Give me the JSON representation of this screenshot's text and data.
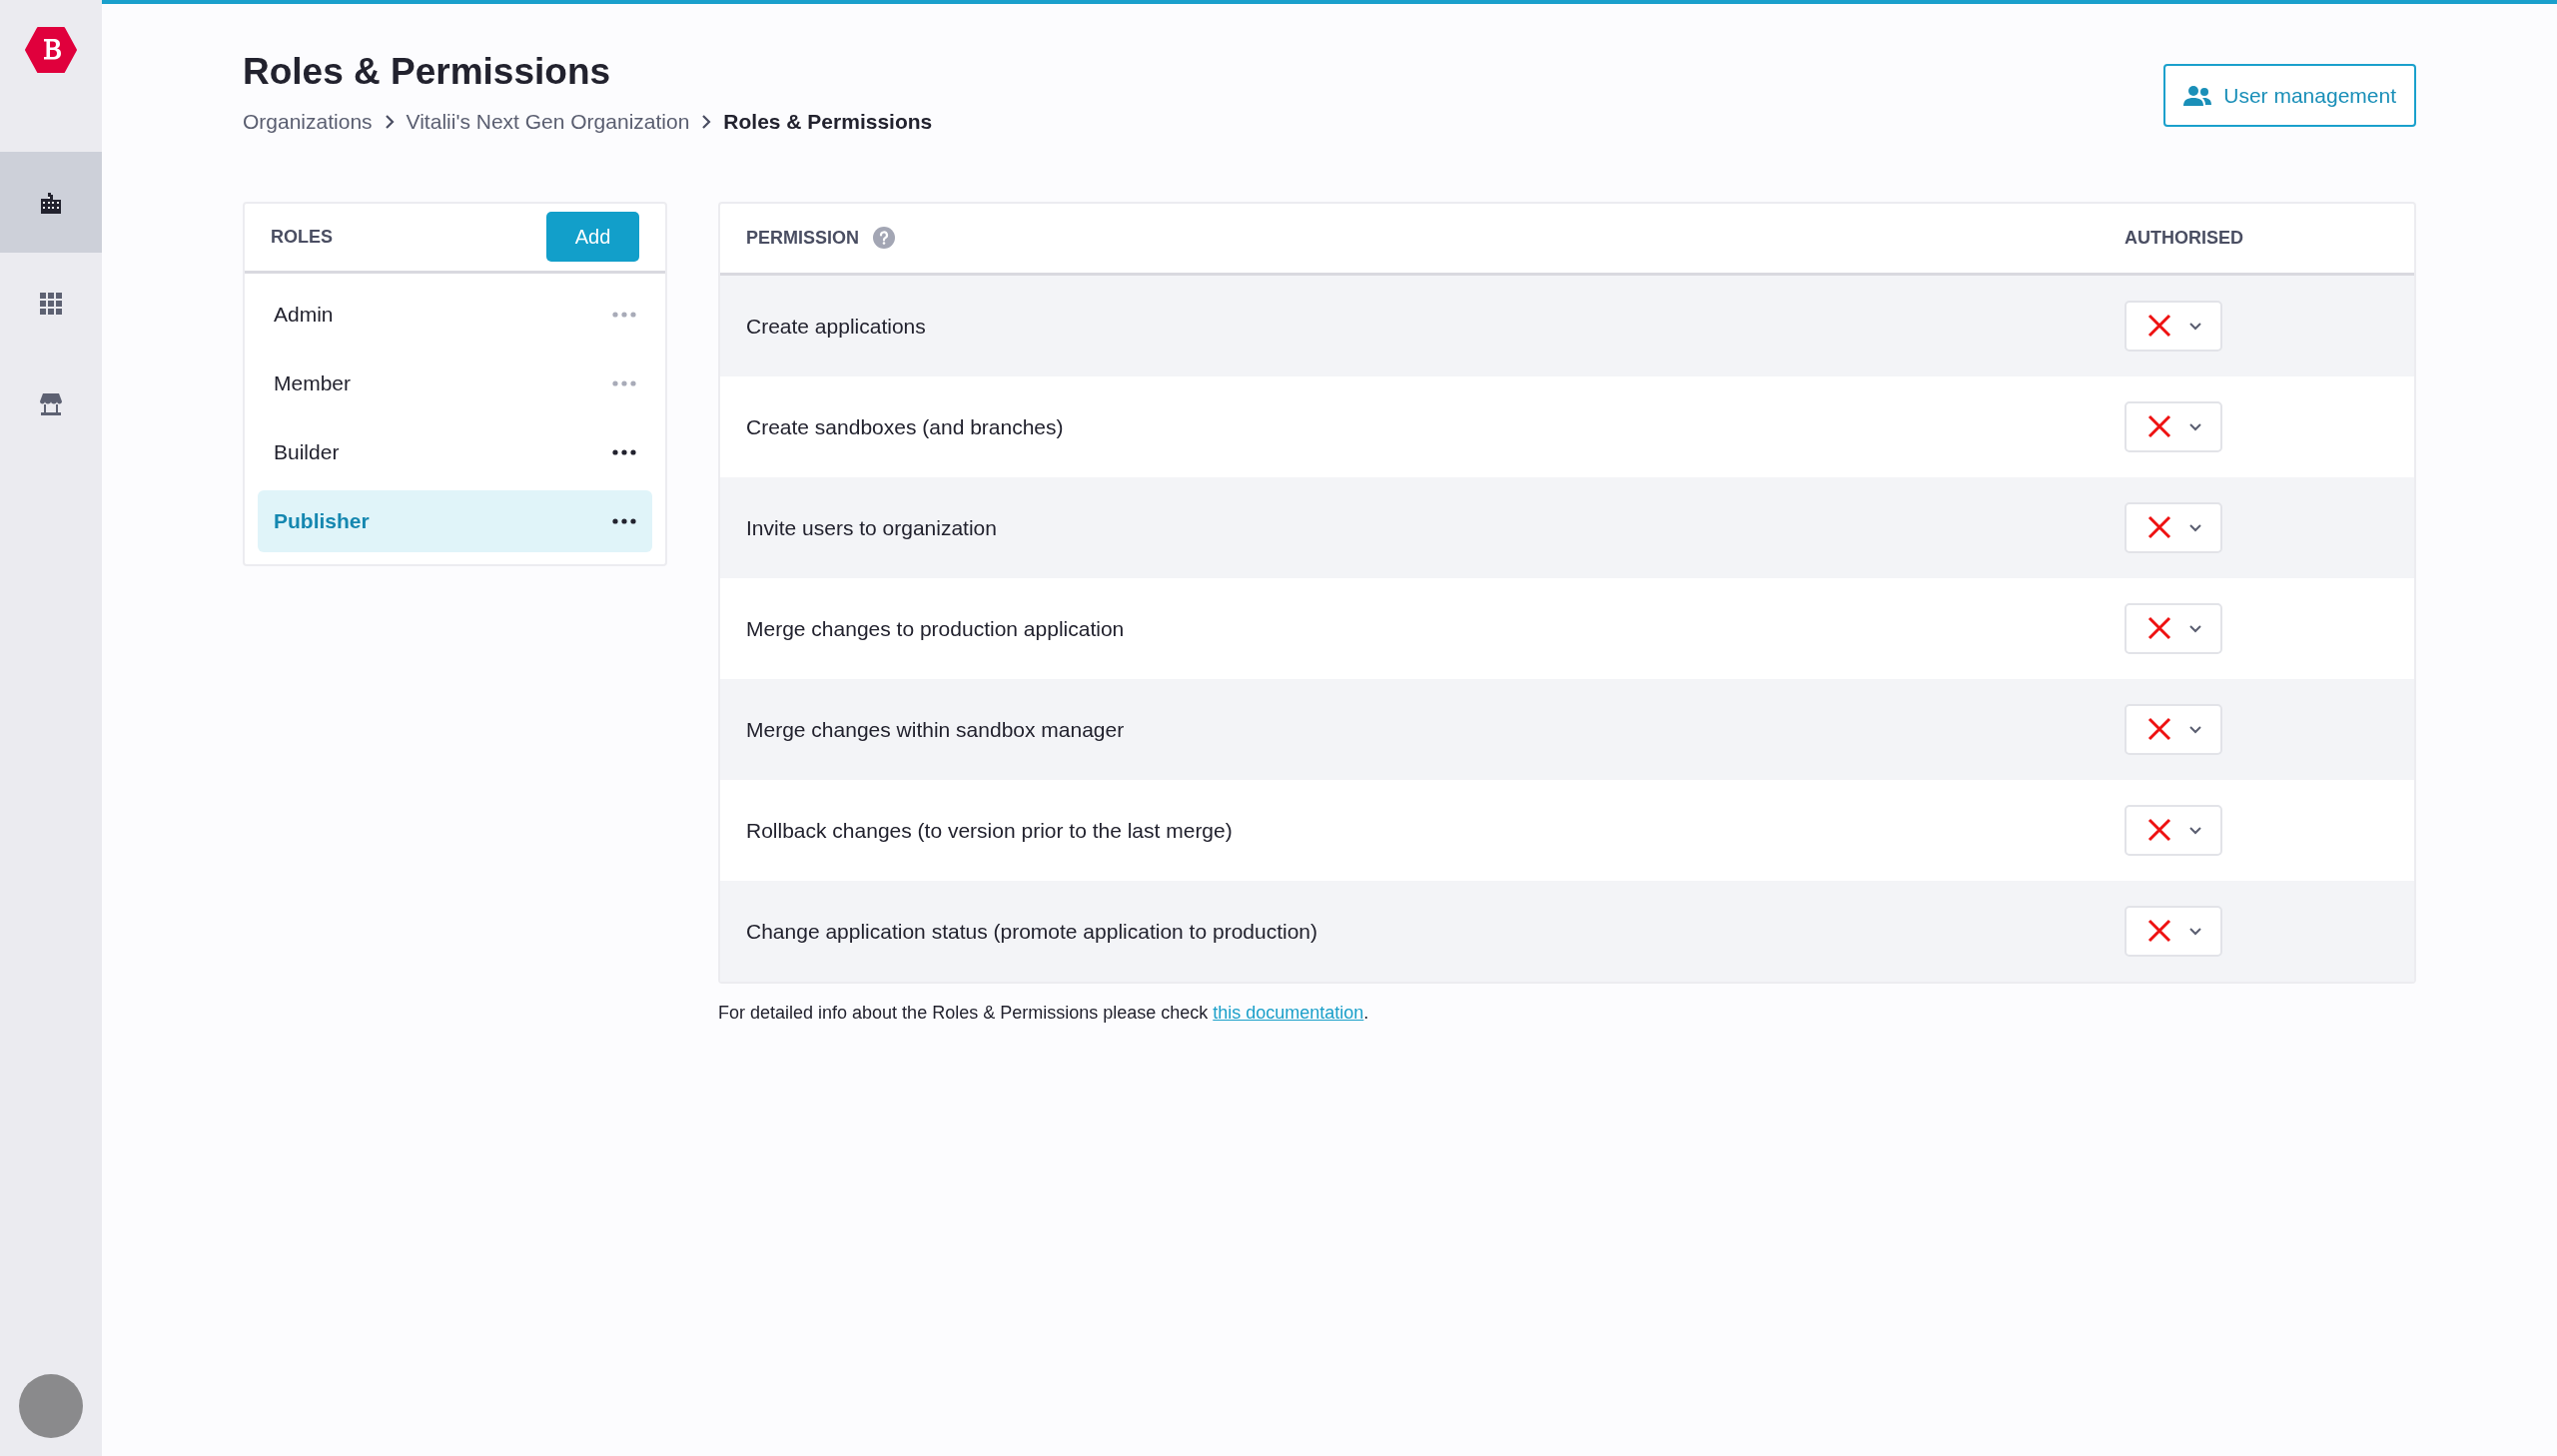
{
  "sidebar": {
    "nav": [
      {
        "kind": "organizations",
        "selected": true
      },
      {
        "kind": "apps",
        "selected": false
      },
      {
        "kind": "store",
        "selected": false
      }
    ]
  },
  "header": {
    "title": "Roles & Permissions",
    "breadcrumb": [
      "Organizations",
      "Vitalii's Next Gen Organization",
      "Roles & Permissions"
    ],
    "action": "User management"
  },
  "roles": {
    "title": "ROLES",
    "add": "Add",
    "items": [
      {
        "name": "Admin",
        "selected": false,
        "menu_disabled": true
      },
      {
        "name": "Member",
        "selected": false,
        "menu_disabled": true
      },
      {
        "name": "Builder",
        "selected": false,
        "menu_disabled": false
      },
      {
        "name": "Publisher",
        "selected": true,
        "menu_disabled": false
      }
    ]
  },
  "permissions": {
    "columns": [
      "PERMISSION",
      "AUTHORISED"
    ],
    "rows": [
      {
        "name": "Create applications",
        "authorised": false
      },
      {
        "name": "Create sandboxes (and branches)",
        "authorised": false
      },
      {
        "name": "Invite users to organization",
        "authorised": false
      },
      {
        "name": "Merge changes to production application",
        "authorised": false
      },
      {
        "name": "Merge changes within sandbox manager",
        "authorised": false
      },
      {
        "name": "Rollback changes (to version prior to the last merge)",
        "authorised": false
      },
      {
        "name": "Change application status (promote application to production)",
        "authorised": false
      }
    ]
  },
  "footer": {
    "text": "For detailed info about the Roles & Permissions please check ",
    "link": "this documentation",
    "after": "."
  }
}
